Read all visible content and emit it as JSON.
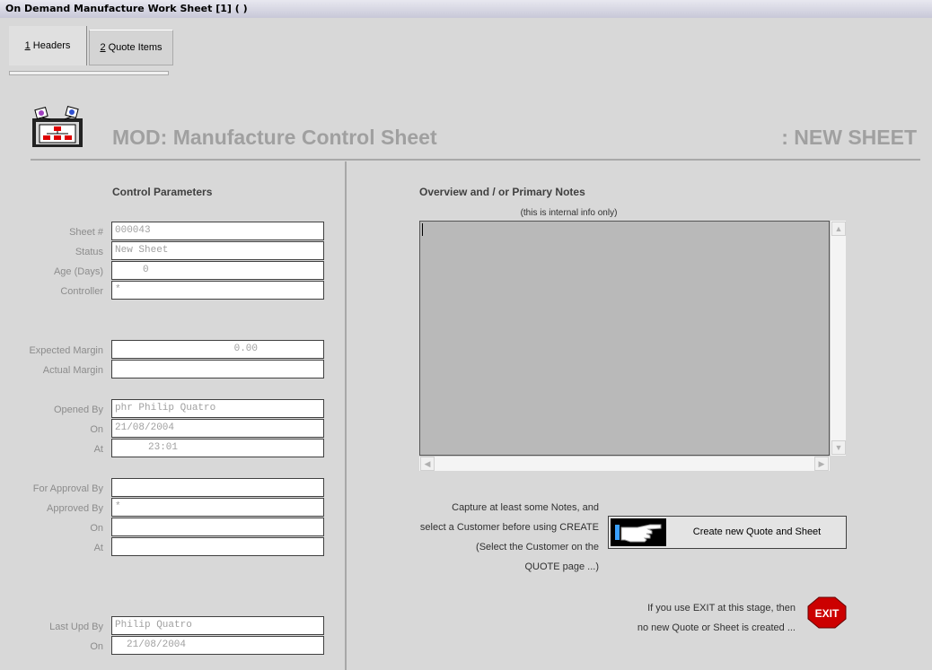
{
  "window": {
    "title": "On Demand Manufacture Work Sheet [1]  ( )"
  },
  "tabs": [
    {
      "label": "1 Headers",
      "accel": "1",
      "rest": " Headers"
    },
    {
      "label": "2 Quote Items",
      "accel": "2",
      "rest": " Quote Items"
    }
  ],
  "header": {
    "title": "MOD: Manufacture Control Sheet",
    "status": ": NEW SHEET"
  },
  "control": {
    "heading": "Control Parameters",
    "fields": {
      "sheet": {
        "label": "Sheet #",
        "value": "000043"
      },
      "status": {
        "label": "Status",
        "value": "New Sheet"
      },
      "age": {
        "label": "Age (Days)",
        "value": "0"
      },
      "controller": {
        "label": "Controller",
        "value": "*"
      },
      "expected_margin": {
        "label": "Expected Margin",
        "value": "0.00"
      },
      "actual_margin": {
        "label": "Actual Margin",
        "value": ""
      },
      "opened_by": {
        "label": "Opened By",
        "value": "phr Philip Quatro"
      },
      "opened_on": {
        "label": "On",
        "value": "21/08/2004"
      },
      "opened_at": {
        "label": "At",
        "value": "23:01"
      },
      "for_approval_by": {
        "label": "For Approval By",
        "value": ""
      },
      "approved_by": {
        "label": "Approved By",
        "value": "*"
      },
      "approved_on": {
        "label": "On",
        "value": ""
      },
      "approved_at": {
        "label": "At",
        "value": ""
      },
      "last_upd_by": {
        "label": "Last Upd By",
        "value": "Philip Quatro"
      },
      "last_upd_on": {
        "label": "On",
        "value": "21/08/2004"
      }
    }
  },
  "notes": {
    "heading": "Overview and / or Primary Notes",
    "subheading": "(this is internal info only)",
    "value": ""
  },
  "create": {
    "hint": [
      "Capture at least some Notes, and",
      "select a Customer before using CREATE",
      "(Select the Customer on the",
      "QUOTE page ...)"
    ],
    "button_label": "Create new Quote and Sheet",
    "icon": "pointing-hand-icon"
  },
  "exit": {
    "hint": [
      "If you use EXIT at this stage, then",
      "no new Quote or Sheet is created ..."
    ],
    "icon_label": "EXIT",
    "color": "#cc0000"
  }
}
